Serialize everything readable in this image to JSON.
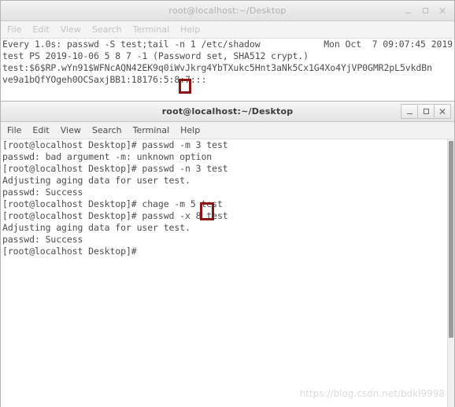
{
  "background_color": "#ffffff",
  "accent_highlight_color": "#8c1616",
  "watermark": {
    "text": "https://blog.csdn.net/bdkl9998"
  },
  "menu": {
    "items": [
      {
        "label": "File"
      },
      {
        "label": "Edit"
      },
      {
        "label": "View"
      },
      {
        "label": "Search"
      },
      {
        "label": "Terminal"
      },
      {
        "label": "Help"
      }
    ]
  },
  "window_buttons": {
    "minimize": "minimize-icon",
    "maximize": "maximize-icon",
    "close": "close-icon"
  },
  "windows": [
    {
      "id": "watch-window",
      "title": "root@localhost:~/Desktop",
      "active": false,
      "lines": [
        {
          "left": "Every 1.0s: passwd -S test;tail -n 1 /etc/shadow",
          "right": "Mon Oct  7 09:07:45 2019",
          "split": true
        },
        {
          "text": ""
        },
        {
          "text": "test PS 2019-10-06 5 8 7 -1 (Password set, SHA512 crypt.)"
        },
        {
          "text": "test:$6$RP.wYn91$WFNcAQN42EK9q0iWvJkrg4YbTXukc5Hnt3aNk5Cx1G4Xo4YjVP0GMR2pL5vkdBn"
        },
        {
          "text": "ve9a1bQfYOgeh0OCSaxjBB1:18176:5:8:7:::"
        }
      ]
    },
    {
      "id": "shell-window",
      "title": "root@localhost:~/Desktop",
      "active": true,
      "lines": [
        {
          "text": "[root@localhost Desktop]# passwd -m 3 test"
        },
        {
          "text": "passwd: bad argument -m: unknown option"
        },
        {
          "text": "[root@localhost Desktop]# passwd -n 3 test"
        },
        {
          "text": "Adjusting aging data for user test."
        },
        {
          "text": "passwd: Success"
        },
        {
          "text": "[root@localhost Desktop]# chage -m 5 test"
        },
        {
          "text": "[root@localhost Desktop]# passwd -x 8 test"
        },
        {
          "text": "Adjusting aging data for user test."
        },
        {
          "text": "passwd: Success"
        },
        {
          "text": "[root@localhost Desktop]#"
        }
      ]
    }
  ],
  "highlights": [
    {
      "name": "shadow-max-days-highlight",
      "value": "8"
    },
    {
      "name": "passwd-x-argument-highlight",
      "value": "8"
    }
  ]
}
